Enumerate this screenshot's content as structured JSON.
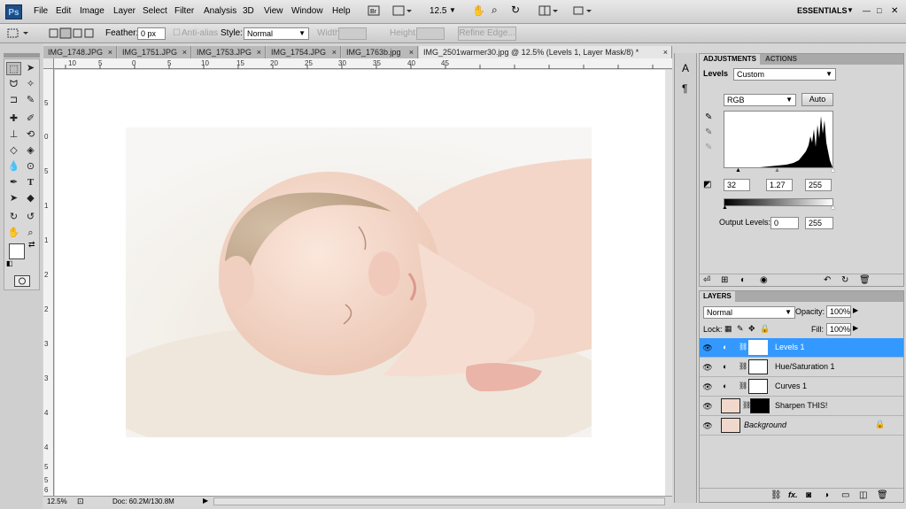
{
  "menubar": {
    "logo": "Ps",
    "items": [
      "File",
      "Edit",
      "Image",
      "Layer",
      "Select",
      "Filter",
      "Analysis",
      "3D",
      "View",
      "Window",
      "Help"
    ],
    "zoom": "12.5",
    "workspace": "ESSENTIALS"
  },
  "options": {
    "feather_label": "Feather:",
    "feather_value": "0 px",
    "antialias_label": "Anti-alias",
    "style_label": "Style:",
    "style_value": "Normal",
    "width_label": "Width:",
    "height_label": "Height:",
    "refine_label": "Refine Edge..."
  },
  "tabs": [
    {
      "label": "IMG_1748.JPG"
    },
    {
      "label": "IMG_1751.JPG"
    },
    {
      "label": "IMG_1753.JPG"
    },
    {
      "label": "IMG_1754.JPG"
    },
    {
      "label": "IMG_1763b.jpg"
    },
    {
      "label": "IMG_2501warmer30.jpg @ 12.5% (Levels 1, Layer Mask/8) *"
    }
  ],
  "hruler_ticks": [
    "10",
    "5",
    "0",
    "5",
    "10",
    "15",
    "20",
    "25",
    "30",
    "35",
    "40",
    "45"
  ],
  "vruler_ticks": [
    "5",
    "0",
    "5",
    "1",
    "1",
    "2",
    "2",
    "3",
    "3",
    "4",
    "4",
    "5",
    "5",
    "6"
  ],
  "status": {
    "zoom": "12.5%",
    "doc": "Doc: 60.2M/130.8M"
  },
  "adjustments": {
    "tab_adjustments": "ADJUSTMENTS",
    "tab_actions": "ACTIONS",
    "title": "Levels",
    "preset": "Custom",
    "channel": "RGB",
    "auto": "Auto",
    "input_black": "32",
    "input_gamma": "1.27",
    "input_white": "255",
    "output_label": "Output Levels:",
    "output_black": "0",
    "output_white": "255"
  },
  "layers": {
    "tab_label": "LAYERS",
    "blend_mode": "Normal",
    "opacity_label": "Opacity:",
    "opacity_value": "100%",
    "lock_label": "Lock:",
    "fill_label": "Fill:",
    "fill_value": "100%",
    "items": [
      {
        "name": "Levels 1"
      },
      {
        "name": "Hue/Saturation 1"
      },
      {
        "name": "Curves 1"
      },
      {
        "name": "Sharpen THIS!"
      },
      {
        "name": "Background"
      }
    ]
  },
  "colors": {
    "selection": "#3399ff",
    "ps_blue": "#1e4e86"
  }
}
